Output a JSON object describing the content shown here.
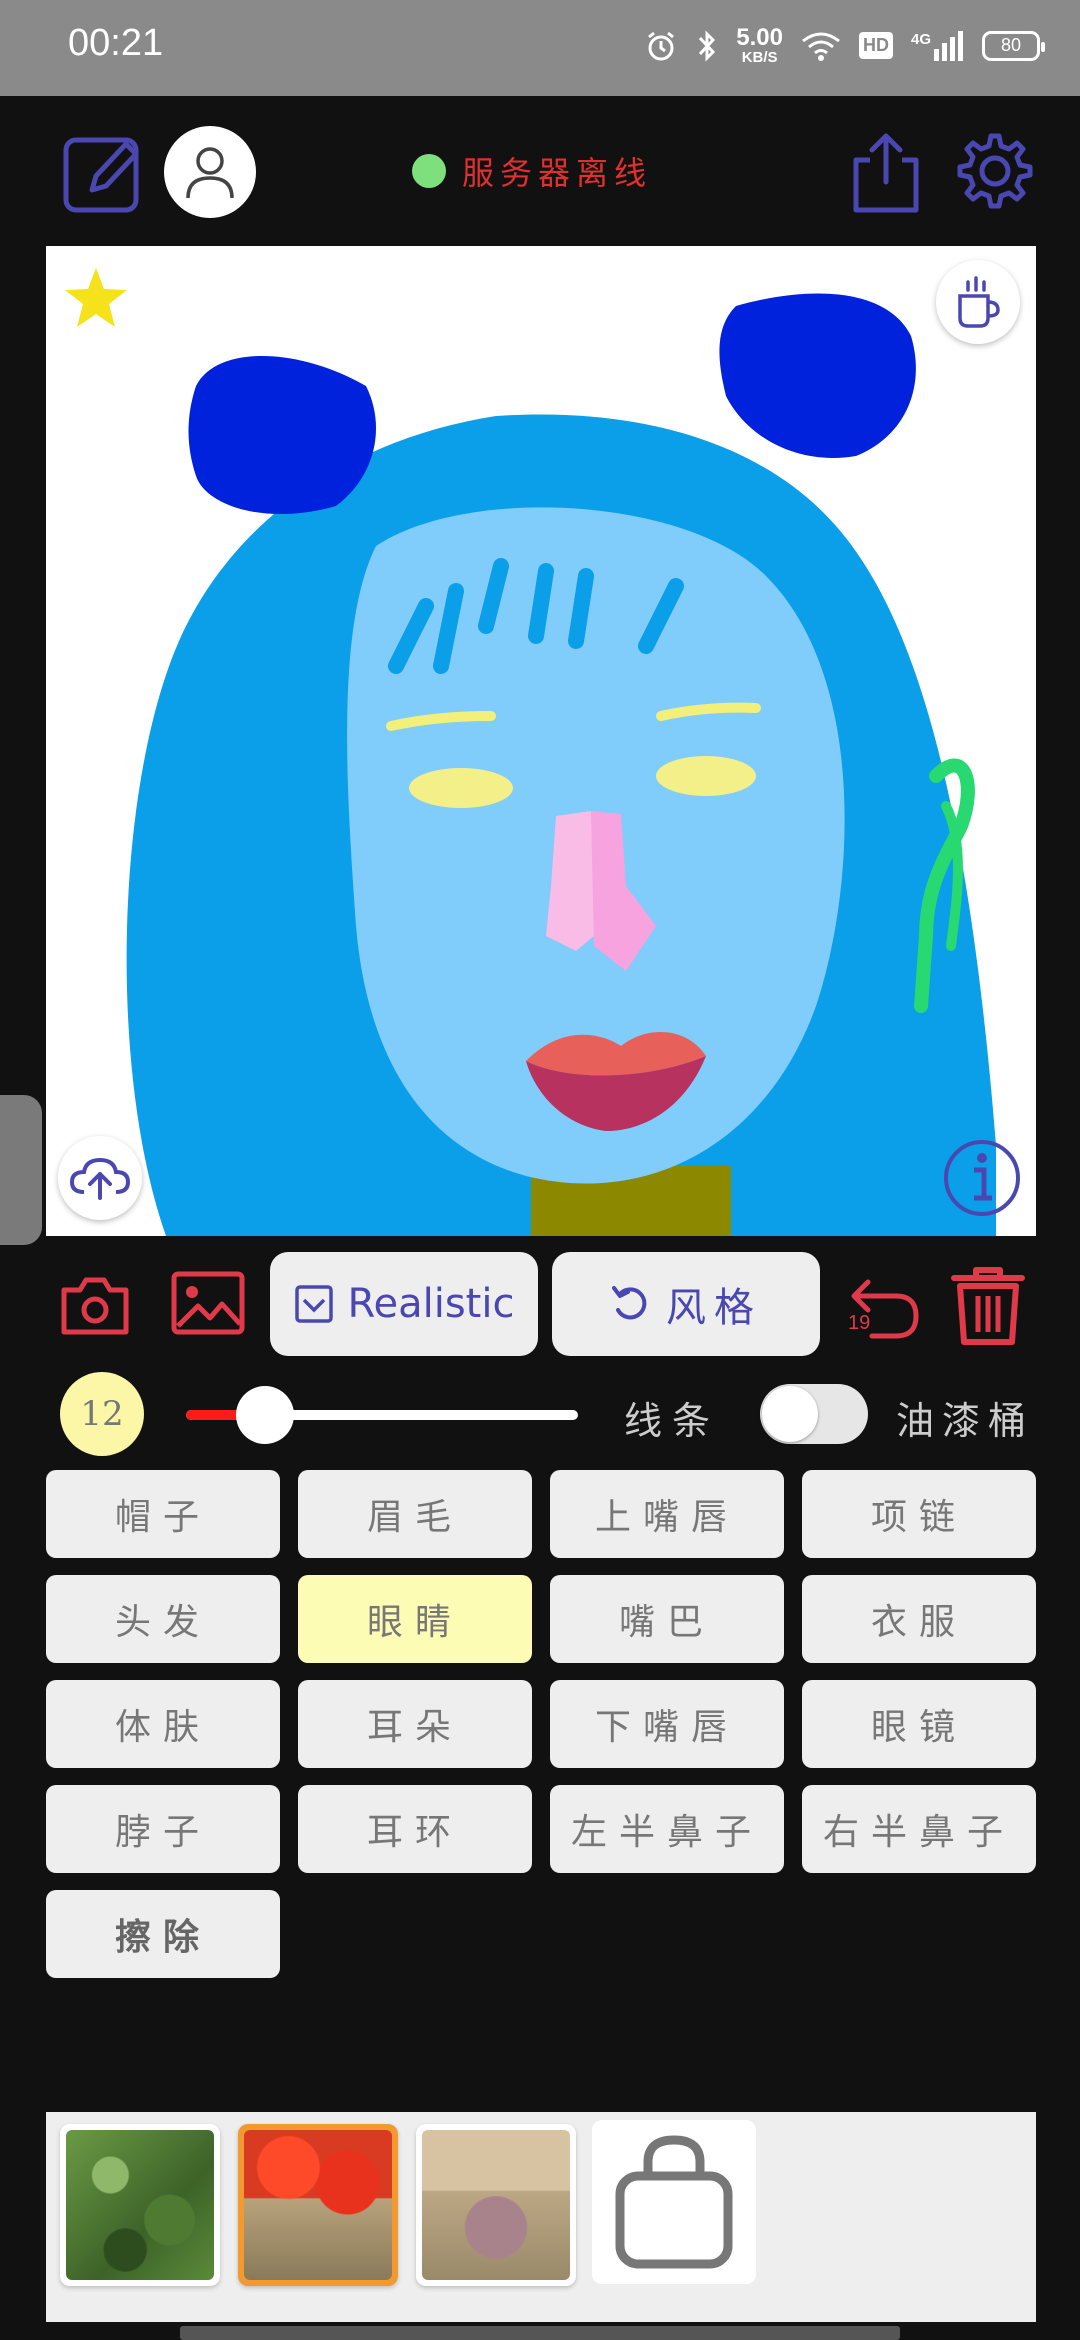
{
  "status_bar": {
    "time": "00:21",
    "speed_value": "5.00",
    "speed_unit": "KB/S",
    "hd_label": "HD",
    "network_label": "4G",
    "battery": "80"
  },
  "header": {
    "server_status": "服务器离线",
    "server_status_color": "#7de07d"
  },
  "toolbar": {
    "realistic_label": "Realistic",
    "style_label": "风格",
    "undo_count": "19"
  },
  "brush": {
    "size": "12",
    "size_fraction": 0.14,
    "line_label": "线条",
    "bucket_label": "油漆桶",
    "bucket_enabled": false
  },
  "parts": [
    {
      "label": "帽子"
    },
    {
      "label": "眉毛"
    },
    {
      "label": "上嘴唇"
    },
    {
      "label": "项链"
    },
    {
      "label": "头发"
    },
    {
      "label": "眼睛"
    },
    {
      "label": "嘴巴"
    },
    {
      "label": "衣服"
    },
    {
      "label": "体肤"
    },
    {
      "label": "耳朵"
    },
    {
      "label": "下嘴唇"
    },
    {
      "label": "眼镜"
    },
    {
      "label": "脖子"
    },
    {
      "label": "耳环"
    },
    {
      "label": "左半鼻子"
    },
    {
      "label": "右半鼻子"
    },
    {
      "label": "擦除"
    }
  ],
  "selected_part": "眼睛",
  "colors": {
    "accent_icon": "#4a48b0",
    "danger": "#e03a4a",
    "selected_part": "#fdfcb4",
    "hair": "#0a9fe8",
    "skin": "#80ccfa",
    "hat": "#0022dd"
  }
}
